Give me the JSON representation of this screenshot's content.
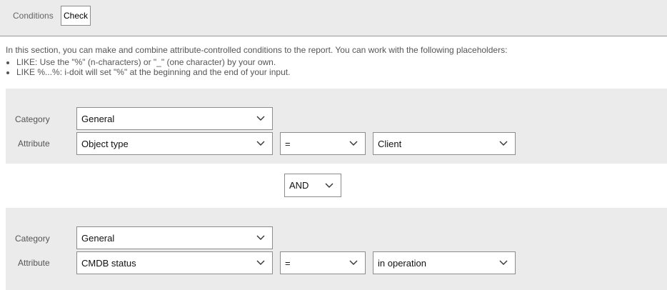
{
  "tabs": {
    "label": "Conditions",
    "button": "Check"
  },
  "intro": {
    "text": "In this section, you can make and combine attribute-controlled conditions to the report. You can work with the following placeholders:",
    "bullets": [
      "LIKE: Use the \"%\" (n-characters) or \"_\" (one character) by your own.",
      "LIKE %...%: i-doit will set \"%\" at the beginning and the end of your input."
    ]
  },
  "conditions": [
    {
      "category_label": "Category",
      "category_value": "General",
      "attribute_label": "Attribute",
      "attribute_value": "Object type",
      "operator_value": "=",
      "value": "Client"
    },
    {
      "category_label": "Category",
      "category_value": "General",
      "attribute_label": "Attribute",
      "attribute_value": "CMDB status",
      "operator_value": "=",
      "value": "in operation"
    }
  ],
  "connector": {
    "value": "AND"
  },
  "icons": {
    "dropdown": "chevron-down-icon"
  }
}
